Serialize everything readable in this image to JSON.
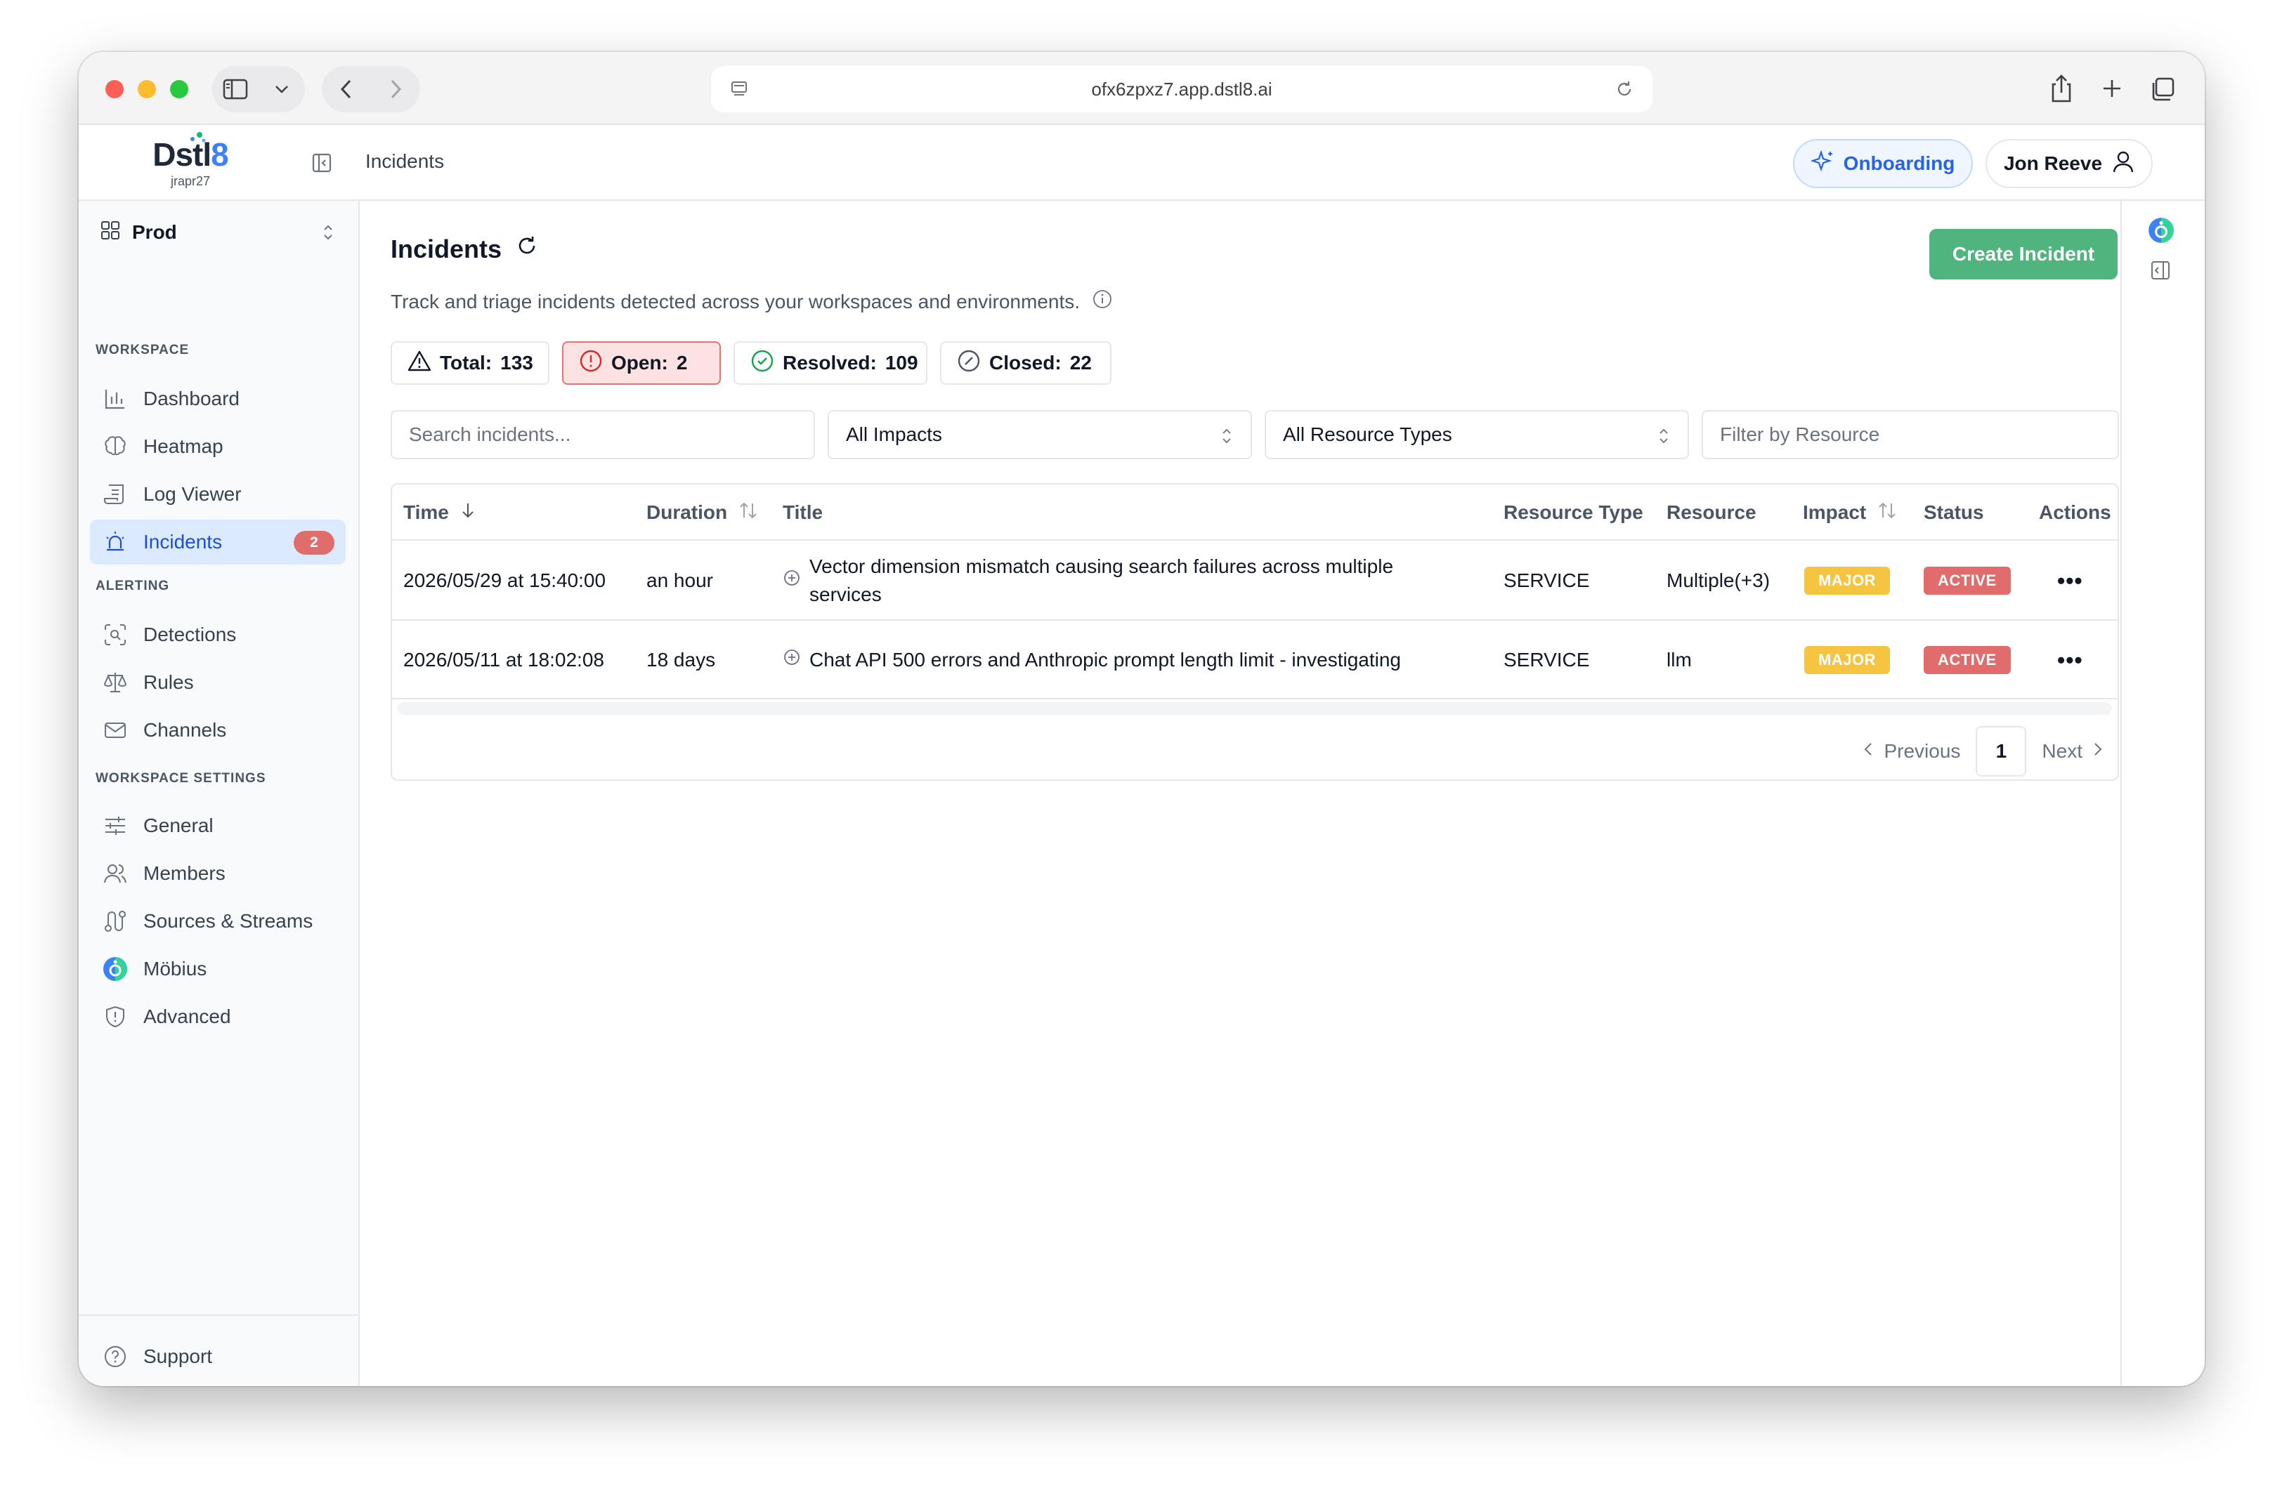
{
  "browser": {
    "url": "ofx6zpxz7.app.dstl8.ai"
  },
  "header": {
    "logo_text": "Dstl",
    "logo_accent": "8",
    "logo_sub": "jrapr27",
    "breadcrumb": "Incidents",
    "onboarding_label": "Onboarding",
    "user_name": "Jon Reeve"
  },
  "sidebar": {
    "environment": "Prod",
    "sections": {
      "workspace": "WORKSPACE",
      "alerting": "ALERTING",
      "settings": "WORKSPACE SETTINGS"
    },
    "items": [
      {
        "label": "Dashboard",
        "icon": "bar-chart-icon"
      },
      {
        "label": "Heatmap",
        "icon": "brain-icon"
      },
      {
        "label": "Log Viewer",
        "icon": "scroll-icon"
      },
      {
        "label": "Incidents",
        "icon": "siren-icon",
        "badge": "2",
        "active": true
      },
      {
        "label": "Detections",
        "icon": "scan-search-icon"
      },
      {
        "label": "Rules",
        "icon": "scale-icon"
      },
      {
        "label": "Channels",
        "icon": "mail-icon"
      },
      {
        "label": "General",
        "icon": "sliders-icon"
      },
      {
        "label": "Members",
        "icon": "users-icon"
      },
      {
        "label": "Sources & Streams",
        "icon": "route-icon"
      },
      {
        "label": "Möbius",
        "icon": "mobius-logo-icon"
      },
      {
        "label": "Advanced",
        "icon": "shield-alert-icon"
      }
    ],
    "support_label": "Support"
  },
  "main": {
    "title": "Incidents",
    "description": "Track and triage incidents detected across your workspaces and environments.",
    "create_button": "Create Incident",
    "stats": {
      "total_label": "Total:",
      "total_value": "133",
      "open_label": "Open:",
      "open_value": "2",
      "resolved_label": "Resolved:",
      "resolved_value": "109",
      "closed_label": "Closed:",
      "closed_value": "22"
    },
    "filters": {
      "search_placeholder": "Search incidents...",
      "impact_selected": "All Impacts",
      "resource_type_selected": "All Resource Types",
      "resource_placeholder": "Filter by Resource"
    },
    "table": {
      "columns": [
        "Time",
        "Duration",
        "Title",
        "Resource Type",
        "Resource",
        "Impact",
        "Status",
        "Actions"
      ],
      "rows": [
        {
          "time": "2026/05/29 at 15:40:00",
          "duration": "an hour",
          "title": "Vector dimension mismatch causing search failures across multiple services",
          "resource_type": "SERVICE",
          "resource": "Multiple(+3)",
          "impact": "MAJOR",
          "status": "ACTIVE"
        },
        {
          "time": "2026/05/11 at 18:02:08",
          "duration": "18 days",
          "title": "Chat API 500 errors and Anthropic prompt length limit - investigating",
          "resource_type": "SERVICE",
          "resource": "llm",
          "impact": "MAJOR",
          "status": "ACTIVE"
        }
      ]
    },
    "pagination": {
      "previous": "Previous",
      "current_page": "1",
      "next": "Next"
    }
  },
  "colors": {
    "accent_blue": "#2563eb",
    "create_green": "#4fb47d",
    "major_yellow": "#f5c542",
    "active_red": "#e06c6c"
  }
}
